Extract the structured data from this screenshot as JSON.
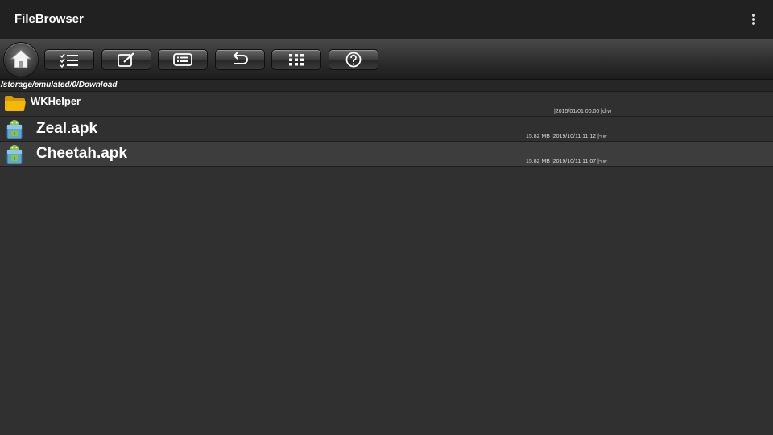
{
  "app": {
    "title": "FileBrowser",
    "overflow_icon": "overflow-vertical-icon"
  },
  "toolbar": {
    "buttons": [
      {
        "id": "home",
        "icon": "home-icon"
      },
      {
        "id": "multi-select",
        "icon": "checklist-icon"
      },
      {
        "id": "edit",
        "icon": "edit-icon"
      },
      {
        "id": "list-view",
        "icon": "list-icon"
      },
      {
        "id": "back",
        "icon": "undo-icon"
      },
      {
        "id": "grid-view",
        "icon": "grid-icon"
      },
      {
        "id": "help",
        "icon": "help-icon"
      }
    ]
  },
  "path": {
    "current": "/storage/emulated/0/Download"
  },
  "files": [
    {
      "name": "WKHelper",
      "type": "folder",
      "icon": "folder-icon",
      "meta": "|2015/01/01 00:00 |drw"
    },
    {
      "name": "Zeal.apk",
      "type": "apk",
      "icon": "apk-icon",
      "meta": "15.82 MB |2019/10/11 11:12 |-rw"
    },
    {
      "name": "Cheetah.apk",
      "type": "apk",
      "icon": "apk-icon",
      "meta": "15.82 MB |2019/10/11 11:07 |-rw"
    }
  ],
  "colors": {
    "actionbar": "#212121",
    "background": "#303030",
    "selected_row": "#3d3d3d",
    "folder": "#f5b800"
  }
}
